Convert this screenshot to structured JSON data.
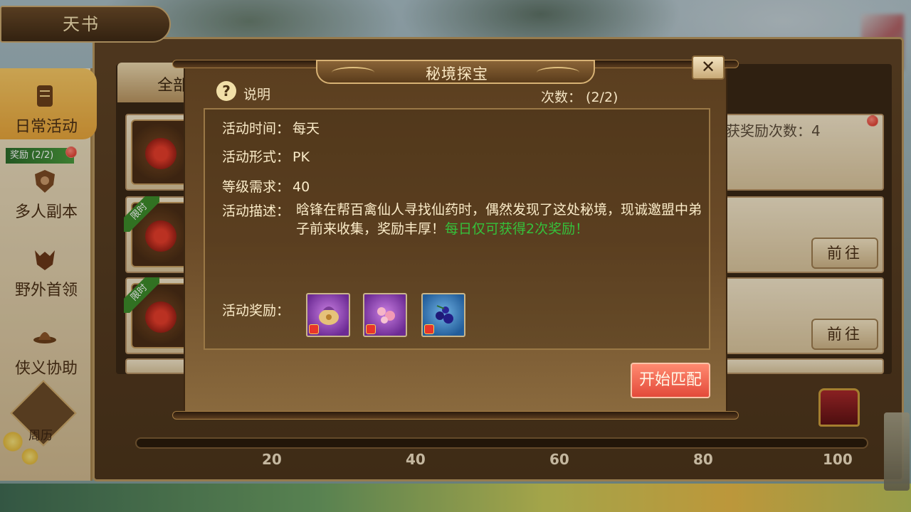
{
  "header": {
    "title": "天书"
  },
  "tabs": {
    "all": "全部"
  },
  "sidebar": {
    "items": [
      {
        "label": "日常活动",
        "active": true
      },
      {
        "label": "多人副本",
        "active": false
      },
      {
        "label": "野外首领",
        "active": false
      },
      {
        "label": "侠义协助",
        "active": false
      }
    ],
    "reward_tag": "奖励 (2/2)",
    "calendar_label": "周历"
  },
  "list": {
    "counter_text": "获奖励次数：4",
    "limit_tag": "限时",
    "go_label": "前往"
  },
  "progress": {
    "ticks": [
      "20",
      "40",
      "60",
      "80",
      "100"
    ]
  },
  "dialog": {
    "title": "秘境探宝",
    "close": "✕",
    "help_icon": "?",
    "help_label": "说明",
    "count_label": "次数： (2/2)",
    "time_key": "活动时间：",
    "time_val": "每天",
    "form_key": "活动形式：",
    "form_val": "PK",
    "level_key": "等级需求：",
    "level_val": "40",
    "desc_key": "活动描述：",
    "desc_text": "晗锋在帮百禽仙人寻找仙药时，偶然发现了这处秘境，现诚邀盟中弟子前来收集，奖励丰厚！",
    "desc_highlight": "每日仅可获得2次奖励！",
    "reward_key": "活动奖励：",
    "rewards": [
      {
        "icon": "pouch-icon",
        "rarity": "purple"
      },
      {
        "icon": "blossom-icon",
        "rarity": "purple"
      },
      {
        "icon": "berries-icon",
        "rarity": "blue"
      }
    ],
    "start_label": "开始匹配"
  },
  "colors": {
    "highlight_green": "#35c13b",
    "start_button": "#e34a3a",
    "active_tab": "#e6a43a"
  }
}
